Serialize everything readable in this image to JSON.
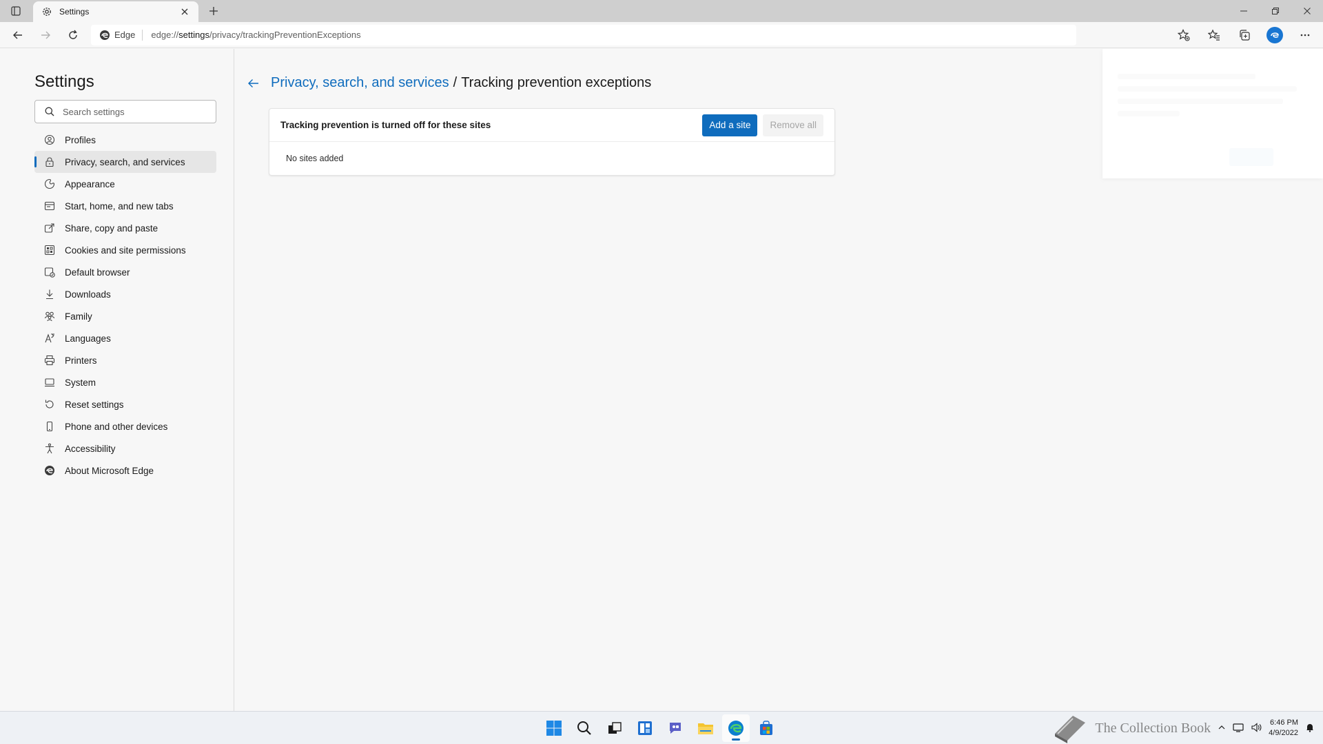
{
  "browser": {
    "tab_title": "Settings",
    "address_prefix": "Edge",
    "url_scheme": "edge://",
    "url_host": "settings",
    "url_path": "/privacy/trackingPreventionExceptions"
  },
  "sidebar": {
    "title": "Settings",
    "search_placeholder": "Search settings",
    "items": [
      {
        "label": "Profiles",
        "icon": "profile-icon"
      },
      {
        "label": "Privacy, search, and services",
        "icon": "lock-icon",
        "active": true
      },
      {
        "label": "Appearance",
        "icon": "appearance-icon"
      },
      {
        "label": "Start, home, and new tabs",
        "icon": "home-tabs-icon"
      },
      {
        "label": "Share, copy and paste",
        "icon": "share-icon"
      },
      {
        "label": "Cookies and site permissions",
        "icon": "cookies-icon"
      },
      {
        "label": "Default browser",
        "icon": "default-browser-icon"
      },
      {
        "label": "Downloads",
        "icon": "download-icon"
      },
      {
        "label": "Family",
        "icon": "family-icon"
      },
      {
        "label": "Languages",
        "icon": "languages-icon"
      },
      {
        "label": "Printers",
        "icon": "printer-icon"
      },
      {
        "label": "System",
        "icon": "system-icon"
      },
      {
        "label": "Reset settings",
        "icon": "reset-icon"
      },
      {
        "label": "Phone and other devices",
        "icon": "phone-icon"
      },
      {
        "label": "Accessibility",
        "icon": "accessibility-icon"
      },
      {
        "label": "About Microsoft Edge",
        "icon": "edge-logo-icon"
      }
    ]
  },
  "main": {
    "breadcrumb_parent": "Privacy, search, and services",
    "breadcrumb_separator": "/",
    "breadcrumb_current": "Tracking prevention exceptions",
    "card_title": "Tracking prevention is turned off for these sites",
    "add_button": "Add a site",
    "remove_button": "Remove all",
    "empty_text": "No sites added"
  },
  "taskbar": {
    "time": "6:46 PM",
    "date": "4/9/2022",
    "watermark": "The Collection Book"
  },
  "colors": {
    "accent": "#0f6cbd",
    "tab_strip": "#cfcfcf",
    "page_bg": "#f7f7f7"
  }
}
